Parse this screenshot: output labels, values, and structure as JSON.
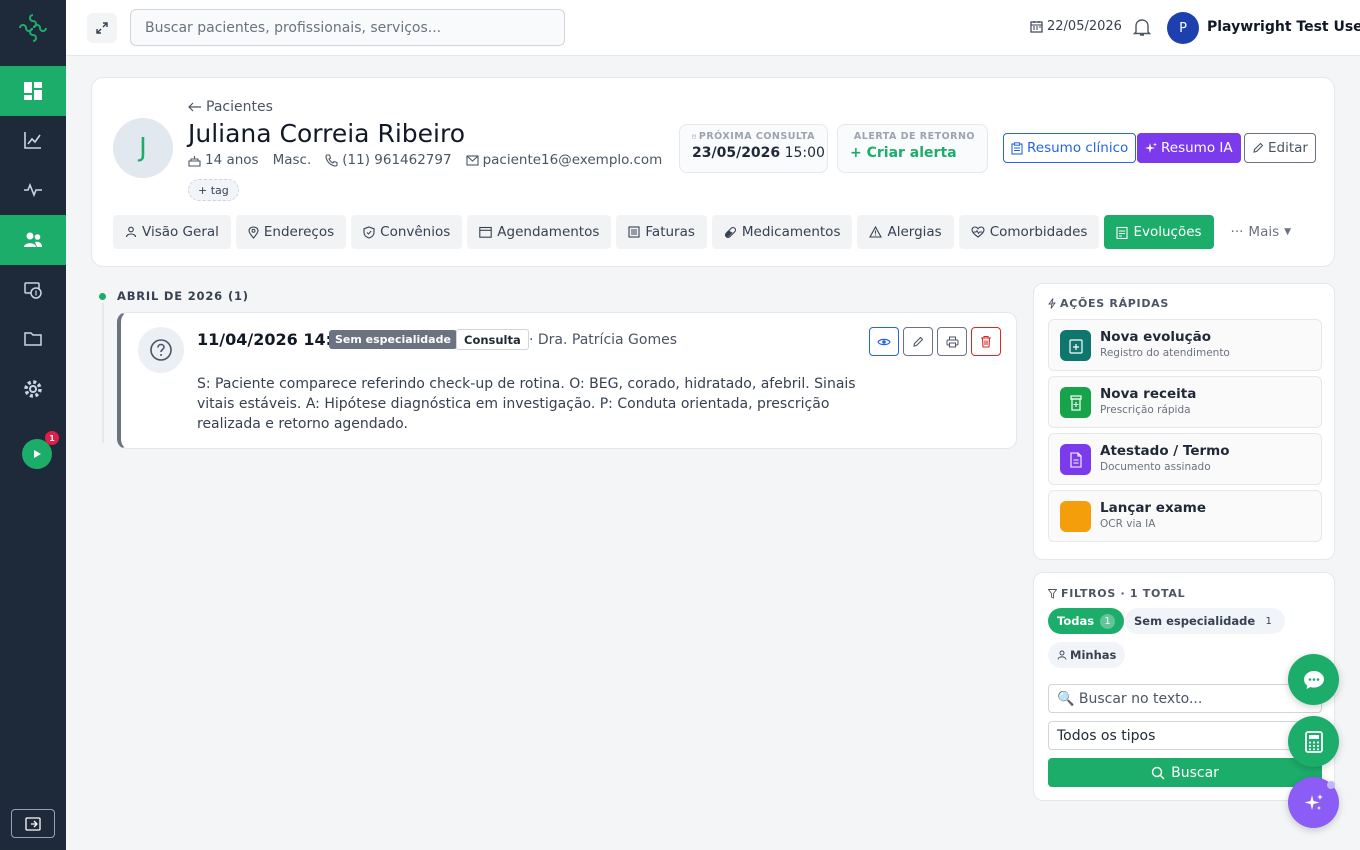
{
  "topbar": {
    "search_placeholder": "Buscar pacientes, profissionais, serviços...",
    "date": "22/05/2026",
    "user_initial": "P",
    "user_name": "Playwright Test User"
  },
  "sidebar": {
    "items": [
      "dashboard",
      "analytics",
      "activity",
      "patients",
      "finance",
      "folders",
      "settings"
    ],
    "active": "patients",
    "badge_count": "1"
  },
  "patient": {
    "back_label": "Pacientes",
    "initial": "J",
    "name": "Juliana Correia Ribeiro",
    "age": "14 anos",
    "sex": "Masc.",
    "phone": "(11) 961462797",
    "email": "paciente16@exemplo.com",
    "tag_button": "+ tag",
    "next_appt_label": "PRÓXIMA CONSULTA",
    "next_appt_date": "23/05/2026",
    "next_appt_time": "15:00",
    "return_alert_label": "ALERTA DE RETORNO",
    "return_alert_action": "+ Criar alerta",
    "btn_resumo": "Resumo clínico",
    "btn_ia": "Resumo IA",
    "btn_edit": "Editar"
  },
  "tabs": [
    {
      "label": "Visão Geral",
      "icon": "user-icon"
    },
    {
      "label": "Endereços",
      "icon": "map-pin-icon"
    },
    {
      "label": "Convênios",
      "icon": "shield-icon"
    },
    {
      "label": "Agendamentos",
      "icon": "calendar-icon"
    },
    {
      "label": "Faturas",
      "icon": "invoice-icon"
    },
    {
      "label": "Medicamentos",
      "icon": "pill-icon"
    },
    {
      "label": "Alergias",
      "icon": "warning-icon"
    },
    {
      "label": "Comorbidades",
      "icon": "heart-pulse-icon"
    },
    {
      "label": "Evoluções",
      "icon": "clipboard-icon",
      "active": true
    }
  ],
  "tabs_more": "Mais",
  "timeline": {
    "month_label": "ABRIL DE 2026",
    "month_count": "(1)",
    "entries": [
      {
        "datetime": "11/04/2026 14:40",
        "specialty": "Sem especialidade",
        "type": "Consulta",
        "professional": "· Dra. Patrícia Gomes",
        "text": "S: Paciente comparece referindo check-up de rotina. O: BEG, corado, hidratado, afebril. Sinais vitais estáveis. A: Hipótese diagnóstica em investigação. P: Conduta orientada, prescrição realizada e retorno agendado."
      }
    ]
  },
  "quick_actions": {
    "title": "AÇÕES RÁPIDAS",
    "items": [
      {
        "title": "Nova evolução",
        "subtitle": "Registro do atendimento",
        "color": "#0f766e"
      },
      {
        "title": "Nova receita",
        "subtitle": "Prescrição rápida",
        "color": "#16a34a"
      },
      {
        "title": "Atestado / Termo",
        "subtitle": "Documento assinado",
        "color": "#7c3aed"
      },
      {
        "title": "Lançar exame",
        "subtitle": "OCR via IA",
        "color": "#f59e0b"
      }
    ]
  },
  "filters": {
    "title": "FILTROS · 1 TOTAL",
    "chip_all": "Todas",
    "chip_all_count": "1",
    "chip_sem": "Sem especialidade",
    "chip_sem_count": "1",
    "chip_mine": "Minhas",
    "search_placeholder": "🔍 Buscar no texto...",
    "type_select": "Todos os tipos",
    "search_button": "Buscar"
  },
  "colors": {
    "brand_green": "#1dad6b",
    "sidebar_bg": "#1e2a3a",
    "ia_purple": "#7c3aed"
  }
}
